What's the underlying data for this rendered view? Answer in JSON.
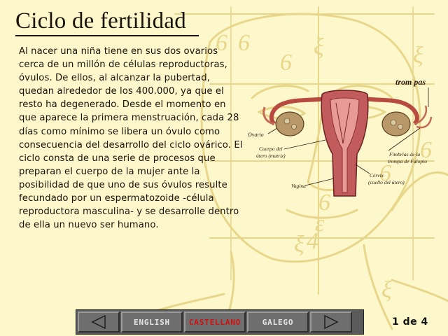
{
  "page": {
    "title": "Ciclo de fertilidad",
    "body": "Al nacer una niña tiene en sus dos ovarios cerca de un millón de células reproductoras, óvulos. De ellos, al alcanzar la pubertad, quedan alrededor de los 400.000, ya que el resto ha degenerado. Desde el momento en que aparece la primera menstruación, cada 28 días como mínimo se libera un óvulo como consecuencia del desarrollo del ciclo ovárico. El ciclo consta de una serie de procesos que preparan el cuerpo de la mujer ante la posibilidad de que uno de sus óvulos resulte fecundado por un espermatozoide -célula reproductora masculina- y se desarrolle dentro de ella un nuevo ser humano."
  },
  "diagram": {
    "heading": "trom pas",
    "labels": {
      "ovario": "Ovario",
      "cuerpo_1": "Cuerpo del",
      "cuerpo_2": "útero (matriz)",
      "vagina": "Vagina",
      "cervix_1": "Cérvix",
      "cervix_2": "(cuello del útero)",
      "fimbrias_1": "Fimbrias de la",
      "fimbrias_2": "trompa de Falopio"
    }
  },
  "toolbar": {
    "prev_icon": "triangle-left-icon",
    "next_icon": "triangle-right-icon",
    "languages": [
      "ENGLISH",
      "CASTELLANO",
      "GALEGO"
    ],
    "active_language": "CASTELLANO",
    "active_color": "#d21010"
  },
  "page_indicator": "1 de 4",
  "colors": {
    "background": "#fdf8cc",
    "sketch": "#e8d68a",
    "toolbar": "#5a5a5a"
  }
}
